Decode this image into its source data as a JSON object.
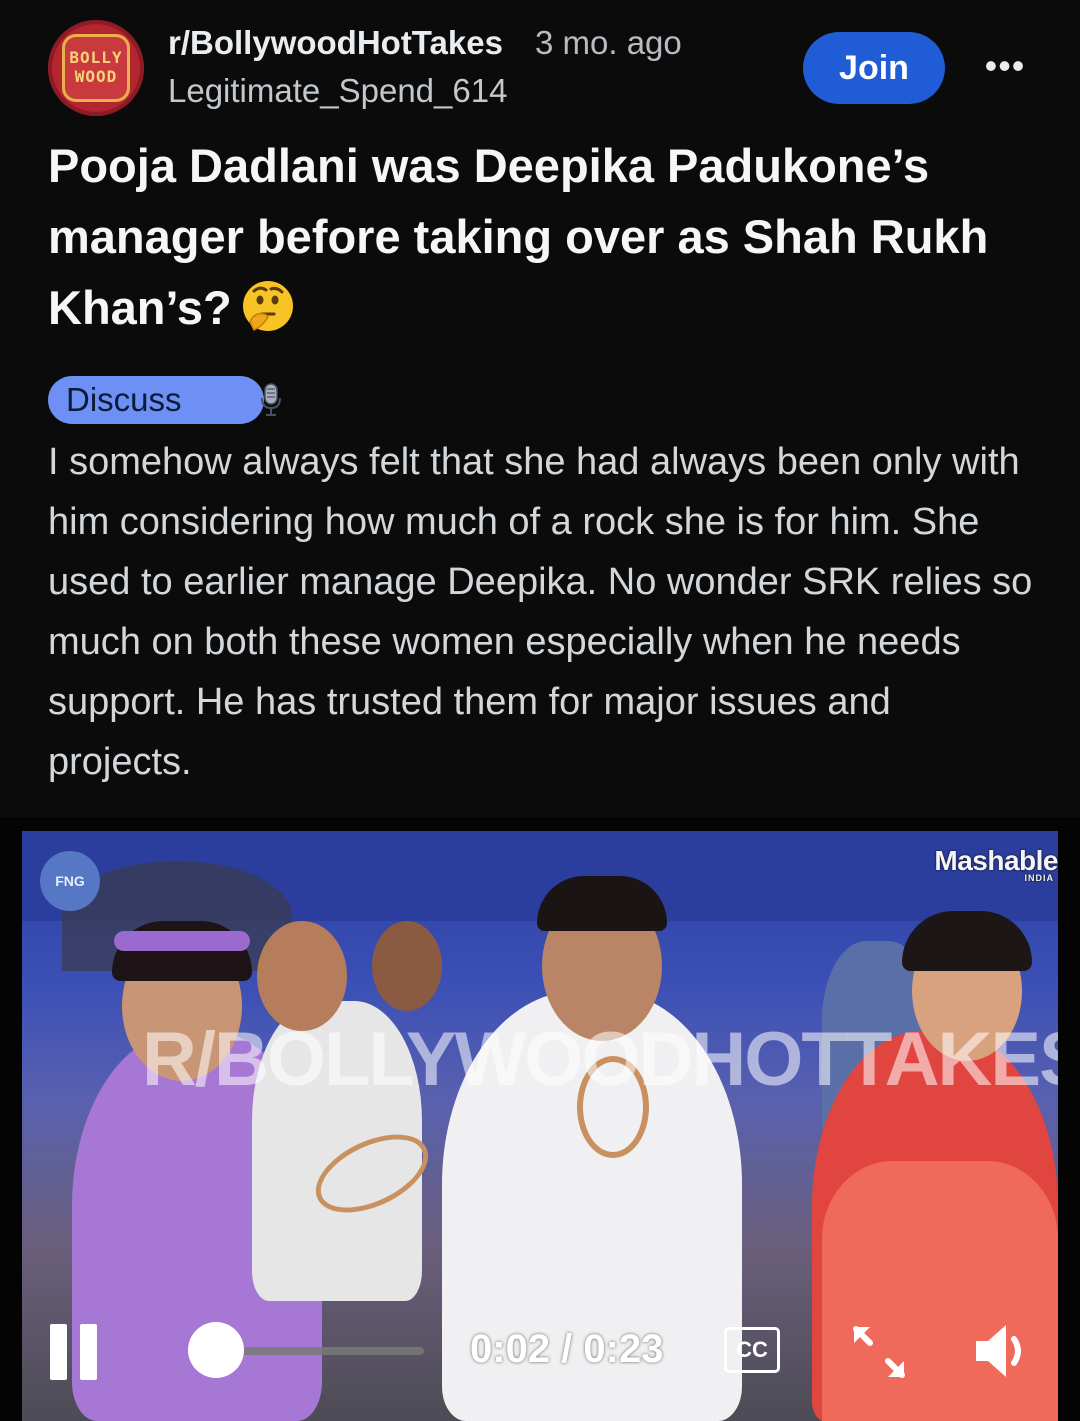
{
  "header": {
    "avatar_text": "BOLLY\nWOOD",
    "subreddit": "r/BollywoodHotTakes",
    "time_ago": "3 mo. ago",
    "author": "Legitimate_Spend_614",
    "join_label": "Join",
    "more_label": "•••"
  },
  "post": {
    "title": "Pooja Dadlani was Deepika Padukone’s manager before taking over as Shah Rukh Khan’s?",
    "title_emoji": "thinking-face-icon",
    "flair": "Discuss",
    "flair_icon": "microphone-icon",
    "flair_color": "#6e8ff3",
    "body": "I somehow always felt that she had always been only with him considering how much of a rock she is for him. She used to earlier manage Deepika. No wonder SRK relies so much on both these women especially when he needs support. He has trusted them for major issues and projects."
  },
  "video": {
    "logo_left": "FNG",
    "logo_right": "Mashable",
    "logo_right_sub": "INDIA",
    "watermark": "R/BOLLYWOODHOTTAKES",
    "current_time": "0:02",
    "duration": "0:23",
    "time_display": "0:02 / 0:23",
    "progress_fraction": 0.087,
    "cc_label": "CC",
    "state": "playing"
  },
  "colors": {
    "background": "#0b0b0c",
    "join_button": "#1f5cd6",
    "text": "#f4f6f7"
  }
}
